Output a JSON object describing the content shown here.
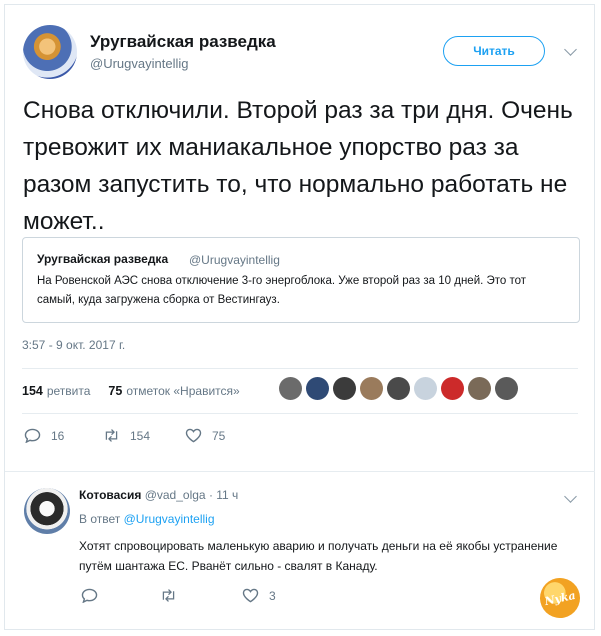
{
  "tweet": {
    "author_name": "Уругвайская разведка",
    "author_handle": "@Urugvayintellig",
    "follow_label": "Читать",
    "text": "Снова отключили. Второй раз за три дня. Очень тревожит их маниакальное упорство раз за разом запустить то, что нормально работать не может..",
    "quote": {
      "author_name": "Уругвайская разведка",
      "author_handle": "@Urugvayintellig",
      "text": "На Ровенской АЭС снова отключение 3-го энергоблока. Уже второй раз за 10 дней. Это тот самый, куда загружена сборка от Вестингауз."
    },
    "timestamp": "3:57 - 9 окт. 2017 г.",
    "stats": {
      "retweets_count": "154",
      "retweets_label": "ретвита",
      "likes_count": "75",
      "likes_label": "отметок «Нравится»"
    },
    "liker_colors": [
      "#6b6b6b",
      "#2f4a75",
      "#3b3b3b",
      "#9a7b5c",
      "#4a4a4a",
      "#c8d3de",
      "#cc2a2a",
      "#7a6a58",
      "#5a5a5a"
    ],
    "actions": {
      "replies": "16",
      "retweets": "154",
      "likes": "75"
    }
  },
  "reply": {
    "author_name": "Котовасия",
    "author_handle": "@vad_olga",
    "time": "· 11 ч",
    "reply_to_label": "В ответ",
    "reply_to_handle": "@Urugvayintellig",
    "text": "Хотят спровоцировать маленькую аварию и получать деньги на её якобы устранение путём шантажа ЕС. Рванёт сильно - свалят в Канаду.",
    "actions": {
      "likes": "3"
    }
  },
  "watermark_text": "Nyka",
  "colors": {
    "accent": "#1da1f2",
    "secondary_text": "#657786",
    "border": "#e1e8ed"
  }
}
